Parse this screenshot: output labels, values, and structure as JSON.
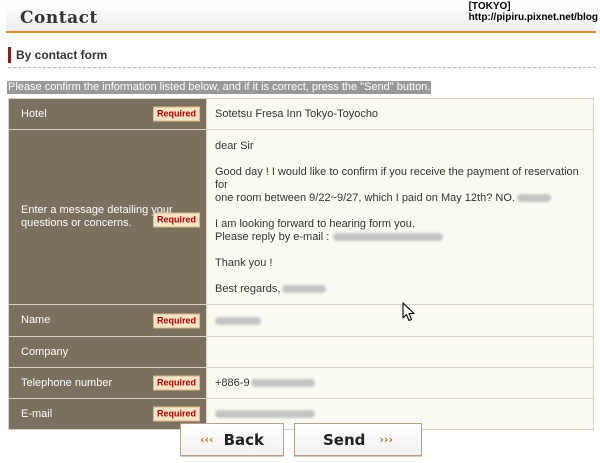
{
  "header": {
    "title": "Contact"
  },
  "watermark": {
    "line1": "[TOKYO]",
    "line2": "http://pipiru.pixnet.net/blog"
  },
  "section": {
    "title": "By contact form"
  },
  "notice": "Please confirm the information listed below, and if it is correct, press the \"Send\" button.",
  "required_label": "Required",
  "fields": {
    "hotel": {
      "label": "Hotel",
      "value": "Sotetsu Fresa Inn Tokyo-Toyocho"
    },
    "message": {
      "label_line1": "Enter a message detailing your",
      "label_line2": "questions or concerns.",
      "greeting": "dear Sir",
      "para1_line1": "Good day ! I would like to confirm if you receive the payment of reservation for",
      "para1_line2": "one room between 9/22~9/27, which I paid on May 12th? NO.",
      "para2_line1": "I am looking forward to hearing form you.",
      "para2_line2": "Please reply by e-mail :",
      "thanks": "Thank you !",
      "regards": "Best regards,"
    },
    "name": {
      "label": "Name"
    },
    "company": {
      "label": "Company"
    },
    "telephone": {
      "label": "Telephone number",
      "value_prefix": "+886-9"
    },
    "email": {
      "label": "E-mail"
    }
  },
  "buttons": {
    "back": "Back",
    "send": "Send"
  },
  "icons": {
    "back_arrows": "arrows-left-icon",
    "send_arrows": "arrows-right-icon",
    "cursor": "mouse-pointer-icon"
  },
  "colors": {
    "label_bg": "#7b705d",
    "accent": "#d9621e",
    "section_bar": "#8a1c1c",
    "required_text": "#b30000"
  }
}
